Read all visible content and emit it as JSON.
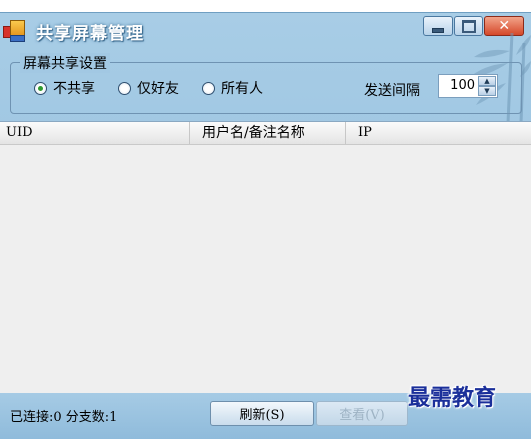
{
  "window": {
    "title": "共享屏幕管理"
  },
  "share_settings": {
    "legend": "屏幕共享设置",
    "options": [
      {
        "label": "不共享",
        "checked": true
      },
      {
        "label": "仅好友",
        "checked": false
      },
      {
        "label": "所有人",
        "checked": false
      }
    ],
    "interval_label": "发送间隔",
    "interval_value": "100"
  },
  "list": {
    "columns": [
      "UID",
      "用户名/备注名称",
      "IP"
    ],
    "rows": []
  },
  "status": {
    "text": "已连接:0 分支数:1",
    "refresh_label": "刷新(S)",
    "view_label": "查看(V)"
  },
  "watermark": "最需教育",
  "colors": {
    "window_bg": "#9cc4e1",
    "title_text": "#ffffff",
    "close_button": "#d5482a",
    "list_bg": "#efefef",
    "watermark": "#1a2f9a"
  },
  "icons": [
    "app-icon",
    "minimize-icon",
    "maximize-icon",
    "close-icon",
    "spin-up-icon",
    "spin-down-icon"
  ]
}
